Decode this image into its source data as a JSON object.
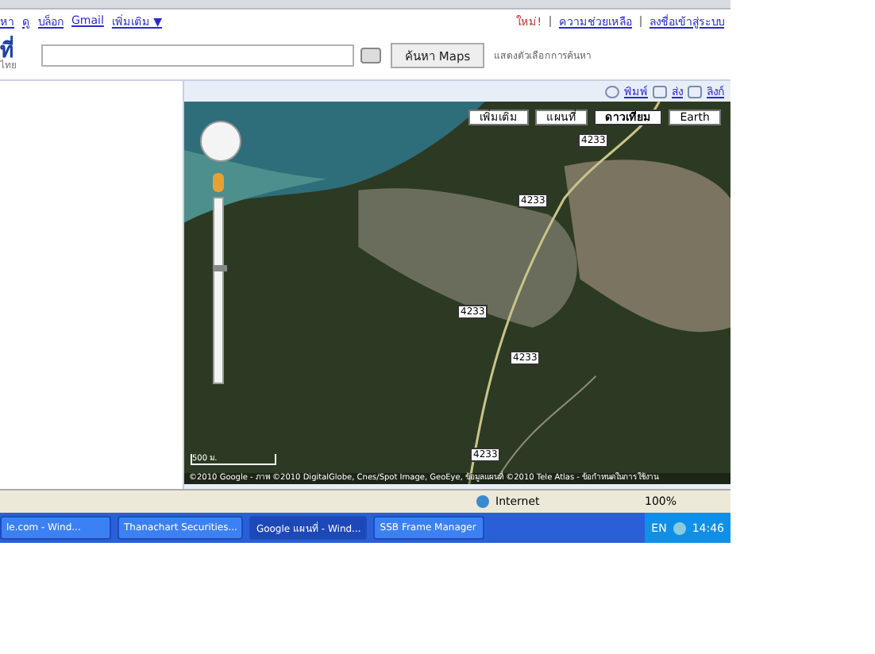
{
  "top_links": {
    "left": [
      "หา",
      "ดู",
      "บล็อก",
      "Gmail",
      "เพิ่มเติม ▼"
    ],
    "new_badge": "ใหม่!",
    "right": [
      "ความช่วยเหลือ",
      "ลงชื่อเข้าสู่ระบบ"
    ]
  },
  "search": {
    "logo": "ที่",
    "logo_sub": "ไทย",
    "button": "ค้นหา Maps",
    "options_link": "แสดงตัวเลือกการค้นหา"
  },
  "map_links": [
    "พิมพ์",
    "ส่ง",
    "ลิงก์"
  ],
  "map_types": [
    {
      "label": "เพิ่มเติม",
      "selected": false
    },
    {
      "label": "แผนที่",
      "selected": false
    },
    {
      "label": "ดาวเทียม",
      "selected": true
    },
    {
      "label": "Earth",
      "selected": false
    }
  ],
  "road_labels": [
    "4233",
    "4233",
    "4233",
    "4233",
    "4233"
  ],
  "zoom_slider": {
    "level": 0.62
  },
  "scale": "500 ม.",
  "attribution": "©2010 Google - ภาพ ©2010 DigitalGlobe, Cnes/Spot Image, GeoEye, ข้อมูลแผนที่ ©2010 Tele Atlas - ข้อกำหนดในการใช้งาน",
  "status_bar": {
    "zone": "Internet",
    "zoom": "100%"
  },
  "taskbar": [
    {
      "label": "le.com - Wind...",
      "selected": false
    },
    {
      "label": "Thanachart Securities...",
      "selected": false
    },
    {
      "label": "Google แผนที่ - Wind...",
      "selected": true
    },
    {
      "label": "SSB Frame Manager",
      "selected": false
    }
  ],
  "tray": {
    "lang": "EN",
    "clock": "14:46"
  }
}
